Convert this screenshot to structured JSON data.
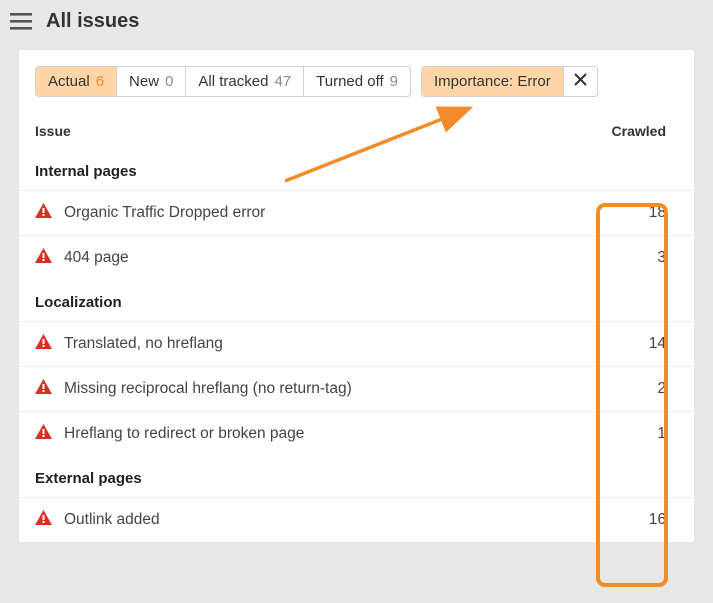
{
  "header": {
    "title": "All issues"
  },
  "accent": "#f28c28",
  "tabs": [
    {
      "label": "Actual",
      "count": "6",
      "active": true
    },
    {
      "label": "New",
      "count": "0",
      "active": false
    },
    {
      "label": "All tracked",
      "count": "47",
      "active": false
    },
    {
      "label": "Turned off",
      "count": "9",
      "active": false
    }
  ],
  "filter": {
    "label": "Importance: Error"
  },
  "columns": {
    "issue": "Issue",
    "crawled": "Crawled"
  },
  "groups": [
    {
      "heading": "Internal pages",
      "issues": [
        {
          "name": "Organic Traffic Dropped error",
          "crawled": 18
        },
        {
          "name": "404 page",
          "crawled": 3
        }
      ]
    },
    {
      "heading": "Localization",
      "issues": [
        {
          "name": "Translated, no hreflang",
          "crawled": 14
        },
        {
          "name": "Missing reciprocal hreflang (no return-tag)",
          "crawled": 2
        },
        {
          "name": "Hreflang to redirect or broken page",
          "crawled": 1
        }
      ]
    },
    {
      "heading": "External pages",
      "issues": [
        {
          "name": "Outlink added",
          "crawled": 16
        }
      ]
    }
  ],
  "icons": {
    "hamburger": "hamburger-icon",
    "close": "close-icon",
    "warning": "warning-icon"
  }
}
